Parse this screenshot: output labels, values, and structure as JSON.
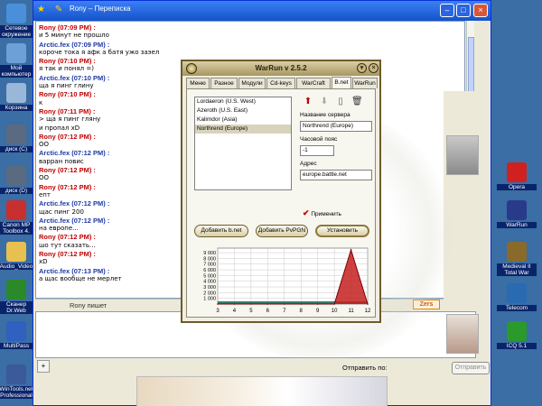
{
  "desktop_left": [
    {
      "label": "Сетевое окружение",
      "color": "#4a8fd9",
      "top": 4
    },
    {
      "label": "Мой компьютер",
      "color": "#6ea0d8",
      "top": 48
    },
    {
      "label": "Корзина",
      "color": "#9ab7d9",
      "top": 92
    },
    {
      "label": "диск (C)",
      "color": "#5a6a80",
      "top": 138
    },
    {
      "label": "диск (D)",
      "color": "#5a6a80",
      "top": 184
    },
    {
      "label": "Canon MP Toolbox 4.",
      "color": "#c83030",
      "top": 222
    },
    {
      "label": "Audio_Video",
      "color": "#e8c050",
      "top": 268
    },
    {
      "label": "Сканер Dr.Web",
      "color": "#2a8a2a",
      "top": 310
    },
    {
      "label": "MultiPass",
      "color": "#3060c0",
      "top": 356
    },
    {
      "label": "WinTools.net Professional",
      "color": "#3a5a9a",
      "top": 404
    }
  ],
  "desktop_right": [
    {
      "label": "Opera",
      "color": "#d02020",
      "top": 180
    },
    {
      "label": "WarRun",
      "color": "#2a3a8a",
      "top": 222
    },
    {
      "label": "Medieval II Total War",
      "color": "#8a6a2a",
      "top": 268
    },
    {
      "label": "Telecom",
      "color": "#2a6ab0",
      "top": 314
    },
    {
      "label": "ICQ 5.1",
      "color": "#2a9a2a",
      "top": 356
    }
  ],
  "icq": {
    "title": "Rony – Переписка",
    "typing": "Rony пишет",
    "zers": "Zers",
    "send_to": "Отправить по:",
    "send_button": "Отправить",
    "attach": "+"
  },
  "messages": [
    {
      "who": "rony",
      "header": "Rony (07:09 PM) :",
      "text": "и 5 минут не прошло"
    },
    {
      "who": "arctic",
      "header": "Arctic.fex (07:09 PM) :",
      "text": "короче тока я афк а батя ужо заэел"
    },
    {
      "who": "rony",
      "header": "Rony (07:10 PM) :",
      "text": "я так и понял =)"
    },
    {
      "who": "arctic",
      "header": "Arctic.fex (07:10 PM) :",
      "text": "ща я пинг глину"
    },
    {
      "who": "rony",
      "header": "Rony (07:10 PM) :",
      "text": "к"
    },
    {
      "who": "rony",
      "header": "Rony (07:11 PM) :",
      "text": "> ща я пинг гляну"
    },
    {
      "who": "rony",
      "header": "",
      "text": "и пропал xD"
    },
    {
      "who": "rony",
      "header": "Rony (07:12 PM) :",
      "text": "OO"
    },
    {
      "who": "arctic",
      "header": "Arctic.fex (07:12 PM) :",
      "text": "варран повис"
    },
    {
      "who": "rony",
      "header": "Rony (07:12 PM) :",
      "text": "OO"
    },
    {
      "who": "rony",
      "header": "Rony (07:12 PM) :",
      "text": "епт"
    },
    {
      "who": "arctic",
      "header": "Arctic.fex (07:12 PM) :",
      "text": "щас пинг 200"
    },
    {
      "who": "arctic",
      "header": "Arctic.fex (07:12 PM) :",
      "text": "на европе..."
    },
    {
      "who": "rony",
      "header": "Rony (07:12 PM) :",
      "text": "шо тут сказать..."
    },
    {
      "who": "rony",
      "header": "Rony (07:12 PM) :",
      "text": "xD"
    },
    {
      "who": "arctic",
      "header": "Arctic.fex (07:13 PM) :",
      "text": "а щас вообще не мерлет"
    }
  ],
  "warrun": {
    "title": "WarRun v 2.5.2",
    "tabs": [
      "Меню",
      "Разное",
      "Модули",
      "Cd-keys",
      "WarCraft",
      "B.net",
      "WarRun"
    ],
    "active_tab": "B.net",
    "servers": [
      "Lordaeron (U.S. West)",
      "Azeroth (U.S. East)",
      "Kalimdor (Asia)",
      "Northrend (Europe)"
    ],
    "selected_server": "Northrend (Europe)",
    "server_name_label": "Название сервера",
    "server_name_value": "Northrend (Europe)",
    "timezone_label": "Часовой пояс",
    "timezone_value": "-1",
    "address_label": "Адрес",
    "address_value": "europe.battle.net",
    "apply_label": "Применить",
    "btn_add_bnet": "Добавить b.net",
    "btn_add_pvpgn": "Добавить PvPGN",
    "btn_set": "Установить"
  },
  "chart_data": {
    "type": "area",
    "x": [
      3,
      4,
      5,
      6,
      7,
      8,
      9,
      10,
      11,
      12
    ],
    "series": [
      {
        "values": [
          0,
          0,
          0,
          0,
          0,
          0,
          0,
          0,
          9500,
          0
        ],
        "color": "#c62020"
      }
    ],
    "yticks": [
      1000,
      2000,
      3000,
      4000,
      5000,
      6000,
      7000,
      8000,
      9000
    ],
    "ylim": [
      0,
      9800
    ],
    "xlim": [
      3,
      12
    ],
    "grid": true,
    "fill_color": "#3a7a6a",
    "background": "#ffffff",
    "grid_color": "#c8c8c8"
  }
}
